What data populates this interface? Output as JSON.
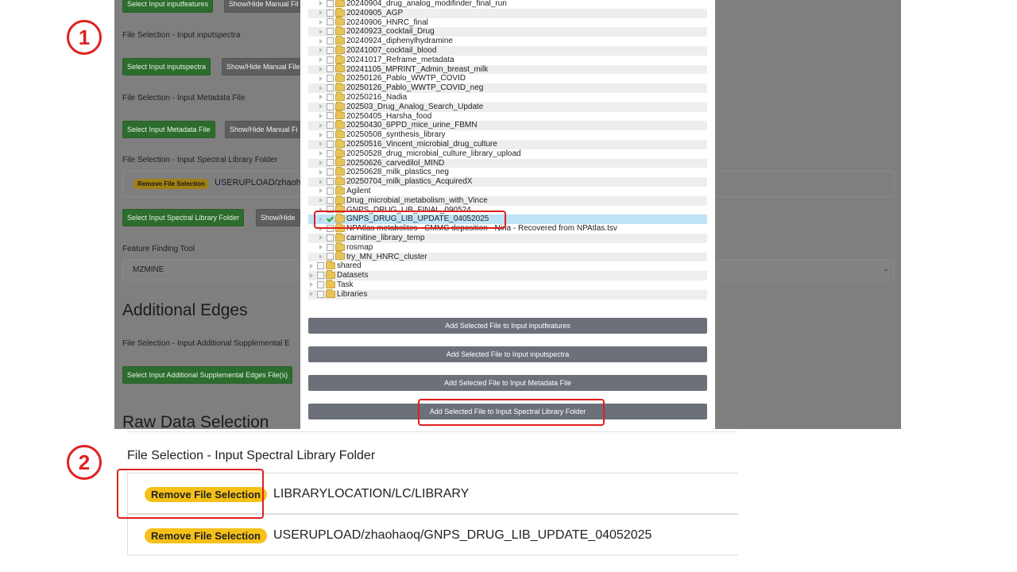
{
  "background": {
    "btn_inputfeatures": "Select Input inputfeatures",
    "showhide_1": "Show/Hide Manual Fil",
    "label_inputspectra": "File Selection - Input inputspectra",
    "btn_inputspectra": "Select Input inputspectra",
    "showhide_2": "Show/Hide Manual File",
    "label_metadata": "File Selection - Input Metadata File",
    "btn_metadata": "Select Input Metadata File",
    "showhide_3": "Show/Hide Manual Fi",
    "label_spectral": "File Selection - Input Spectral Library Folder",
    "remove_label": "Remove File Selection",
    "selected_path": "USERUPLOAD/zhaohaoq",
    "btn_spectral": "Select Input Spectral Library Folder",
    "showhide_4": "Show/Hide",
    "label_feature_tool": "Feature Finding Tool",
    "feature_tool_value": "MZMINE",
    "heading_additional": "Additional Edges",
    "label_additional": "File Selection - Input Additional Supplemental E",
    "btn_additional": "Select Input Additional Supplemental Edges File(s)",
    "heading_raw": "Raw Data Selection"
  },
  "tree": [
    {
      "label": "20240904_drug_analog_modifinder_final_run",
      "depth": 1,
      "checked": false
    },
    {
      "label": "20240905_AGP",
      "depth": 1,
      "checked": false
    },
    {
      "label": "20240906_HNRC_final",
      "depth": 1,
      "checked": false
    },
    {
      "label": "20240923_cocktail_Drug",
      "depth": 1,
      "checked": false
    },
    {
      "label": "20240924_diphenylhydramine",
      "depth": 1,
      "checked": false
    },
    {
      "label": "20241007_cocktail_blood",
      "depth": 1,
      "checked": false
    },
    {
      "label": "20241017_Reframe_metadata",
      "depth": 1,
      "checked": false
    },
    {
      "label": "20241105_MPRINT_Admin_breast_milk",
      "depth": 1,
      "checked": false
    },
    {
      "label": "20250126_Pablo_WWTP_COVID",
      "depth": 1,
      "checked": false
    },
    {
      "label": "20250126_Pablo_WWTP_COVID_neg",
      "depth": 1,
      "checked": false
    },
    {
      "label": "20250216_Nadia",
      "depth": 1,
      "checked": false
    },
    {
      "label": "202503_Drug_Analog_Search_Update",
      "depth": 1,
      "checked": false
    },
    {
      "label": "20250405_Harsha_food",
      "depth": 1,
      "checked": false
    },
    {
      "label": "20250430_6PPD_mice_urine_FBMN",
      "depth": 1,
      "checked": false
    },
    {
      "label": "20250508_synthesis_library",
      "depth": 1,
      "checked": false
    },
    {
      "label": "20250516_Vincent_microbial_drug_culture",
      "depth": 1,
      "checked": false
    },
    {
      "label": "20250528_drug_microbial_culture_library_upload",
      "depth": 1,
      "checked": false
    },
    {
      "label": "20250626_carvedilol_MIND",
      "depth": 1,
      "checked": false
    },
    {
      "label": "20250628_milk_plastics_neg",
      "depth": 1,
      "checked": false
    },
    {
      "label": "20250704_milk_plastics_AcquiredX",
      "depth": 1,
      "checked": false
    },
    {
      "label": "Agilent",
      "depth": 1,
      "checked": false
    },
    {
      "label": "Drug_microbial_metabolism_with_Vince",
      "depth": 1,
      "checked": false
    },
    {
      "label": "GNPS_DRUG_LIB_FINAL_090524",
      "depth": 1,
      "checked": false
    },
    {
      "label": "GNPS_DRUG_LIB_UPDATE_04052025",
      "depth": 1,
      "checked": true,
      "selected": true
    },
    {
      "label": "NPAtlas metabolites - CMMC deposition - Nina - Recovered from NPAtlas.tsv",
      "depth": 1,
      "checked": false
    },
    {
      "label": "carnitine_library_temp",
      "depth": 1,
      "checked": false
    },
    {
      "label": "rosmap",
      "depth": 1,
      "checked": false
    },
    {
      "label": "try_MN_HNRC_cluster",
      "depth": 1,
      "checked": false
    },
    {
      "label": "shared",
      "depth": 0,
      "checked": false
    },
    {
      "label": "Datasets",
      "depth": 0,
      "checked": false
    },
    {
      "label": "Task",
      "depth": 0,
      "checked": false
    },
    {
      "label": "Libraries",
      "depth": 0,
      "checked": false
    }
  ],
  "modal_buttons": [
    "Add Selected File to Input inputfeatures",
    "Add Selected File to Input inputspectra",
    "Add Selected File to Input Metadata File",
    "Add Selected File to Input Spectral Library Folder"
  ],
  "steps": {
    "one": "1",
    "two": "2"
  },
  "zoom": {
    "label": "File Selection - Input Spectral Library Folder",
    "rows": [
      {
        "badge": "Remove File Selection",
        "path": "LIBRARYLOCATION/LC/LIBRARY"
      },
      {
        "badge": "Remove File Selection",
        "path": "USERUPLOAD/zhaohaoq/GNPS_DRUG_LIB_UPDATE_04052025"
      }
    ]
  },
  "colors": {
    "annotation": "#e02020",
    "badge": "#f5c018",
    "select_button": "#28a745",
    "selected_row": "#bfe4f7"
  }
}
